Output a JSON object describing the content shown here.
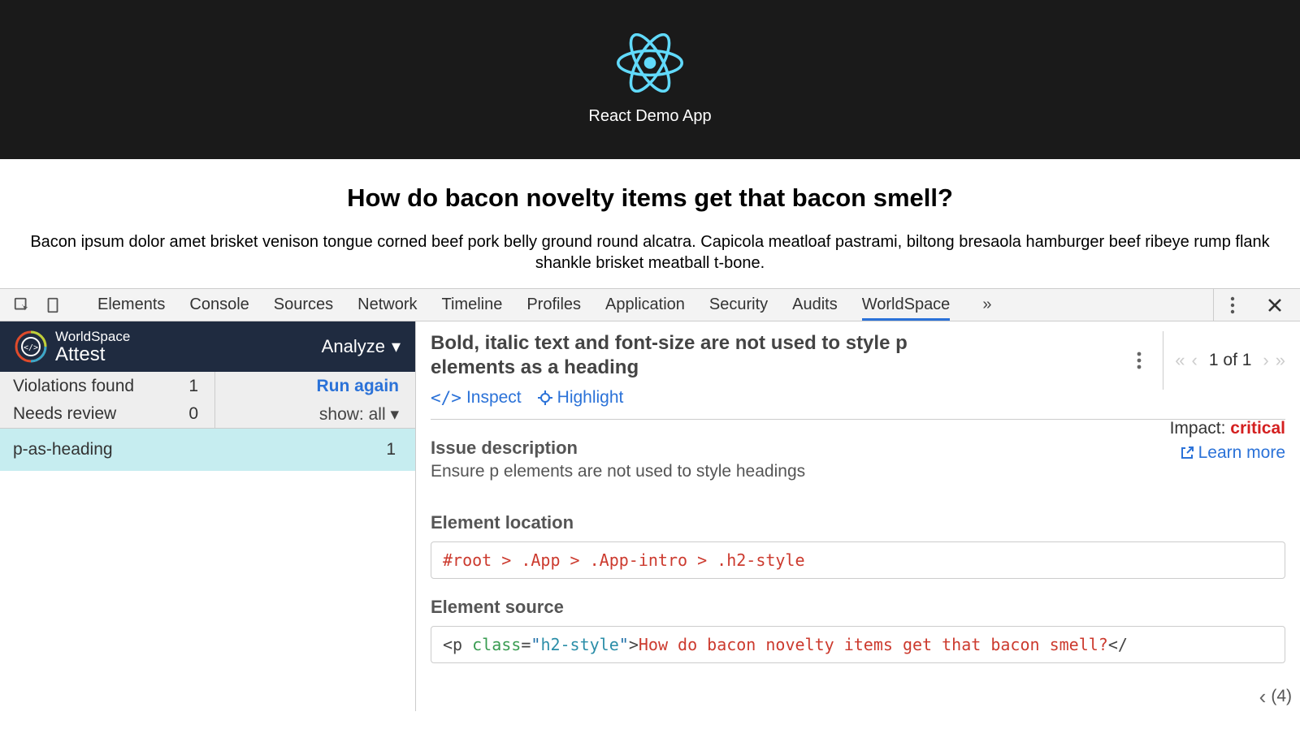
{
  "app": {
    "title": "React Demo App"
  },
  "page": {
    "heading": "How do bacon novelty items get that bacon smell?",
    "body": "Bacon ipsum dolor amet brisket venison tongue corned beef pork belly ground round alcatra. Capicola meatloaf pastrami, biltong bresaola hamburger beef ribeye rump flank shankle brisket meatball t-bone."
  },
  "devtools": {
    "tabs": [
      "Elements",
      "Console",
      "Sources",
      "Network",
      "Timeline",
      "Profiles",
      "Application",
      "Security",
      "Audits",
      "WorldSpace"
    ],
    "active_tab": "WorldSpace",
    "overflow": "»"
  },
  "attest": {
    "brand_top": "WorldSpace",
    "brand_bottom": "Attest",
    "analyze": "Analyze",
    "sub": {
      "violations_label": "Violations found",
      "violations_count": "1",
      "needs_review_label": "Needs review",
      "needs_review_count": "0",
      "run_again": "Run again",
      "show_all": "show: all"
    },
    "selected_rule": {
      "id": "p-as-heading",
      "count": "1"
    }
  },
  "issue": {
    "title": "Bold, italic text and font-size are not used to style p elements as a heading",
    "inspect": "Inspect",
    "highlight": "Highlight",
    "nav_count": "1 of 1",
    "desc_label": "Issue description",
    "desc_text": "Ensure p elements are not used to style headings",
    "impact_label": "Impact: ",
    "impact_value": "critical",
    "learn_more": "Learn more",
    "loc_label": "Element location",
    "loc_value": "#root > .App > .App-intro > .h2-style",
    "src_label": "Element source",
    "src_open": "<p ",
    "src_attr": "class",
    "src_eq": "=",
    "src_q1": "\"",
    "src_val": "h2-style",
    "src_q2": "\"",
    "src_close": ">",
    "src_text": "How do bacon novelty items get that bacon smell?",
    "src_end": "</"
  },
  "footer": {
    "count": "(4)"
  }
}
